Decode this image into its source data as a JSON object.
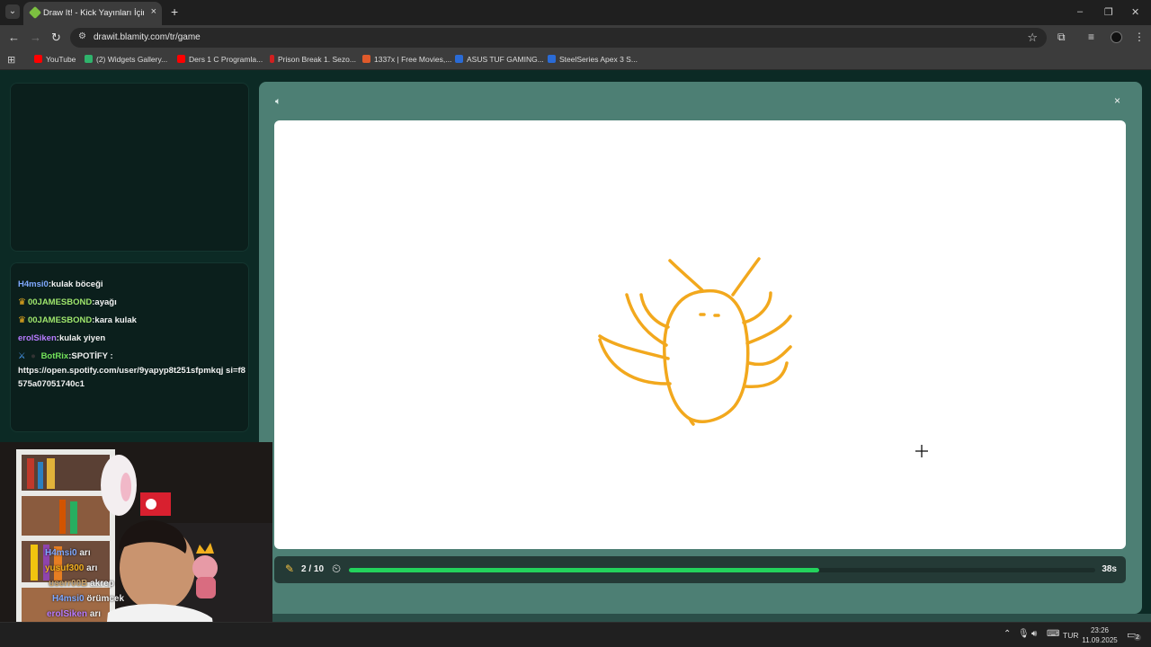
{
  "browser": {
    "tab_title": "Draw It! - Kick Yayınları İçin Çizim",
    "tab_close": "×",
    "new_tab": "+",
    "url": "drawit.blamity.com/tr/game",
    "window_controls": [
      "–",
      "❐",
      "✕"
    ],
    "bookmarks": [
      {
        "label": "YouTube",
        "color": "#ff0000"
      },
      {
        "label": "(2) Widgets Gallery...",
        "color": "#2fb36c"
      },
      {
        "label": "Ders 1 C Programla...",
        "color": "#ff0000"
      },
      {
        "label": "Prison Break 1. Sezo...",
        "color": "#d02020"
      },
      {
        "label": "1337x | Free Movies,...",
        "color": "#e05a2b"
      },
      {
        "label": "ASUS TUF GAMING...",
        "color": "#2a6bd6"
      },
      {
        "label": "SteelSeries Apex 3 S...",
        "color": "#2a6bd6"
      }
    ]
  },
  "chat": {
    "messages": [
      {
        "user": "H4msi0",
        "user_color": "blue",
        "text": ":kulak böceği",
        "crown": false
      },
      {
        "user": "00JAMESBOND",
        "user_color": "green",
        "text": ":ayağı",
        "crown": true
      },
      {
        "user": "00JAMESBOND",
        "user_color": "green",
        "text": ":kara kulak",
        "crown": true
      },
      {
        "user": "erolSiken",
        "user_color": "purple",
        "text": ":kulak yiyen",
        "crown": false
      }
    ],
    "bot": {
      "user": "BotRix",
      "text": ":SPOTİFY :"
    },
    "bot_link": "https://open.spotify.com/user/9yapyp8t251sfpmkqj si=f8575a07051740c1"
  },
  "game": {
    "round": "2 / 10",
    "progress_fraction": 0.63,
    "seconds": "38s",
    "sound_icon": "speaker-icon",
    "close": "×"
  },
  "webcam_chat": [
    {
      "user": "H4msi0",
      "text": "arı",
      "color": "#7fa9ff"
    },
    {
      "user": "yusuf300",
      "text": "arı",
      "color": "#f2b01e"
    },
    {
      "user": "userr00B",
      "text": "akrep",
      "color": "#c9a36b"
    },
    {
      "user": "H4msi0",
      "text": "örümcek",
      "color": "#7fa9ff"
    },
    {
      "user": "erolSiken",
      "text": "arı",
      "color": "#b77bff"
    }
  ],
  "taskbar": {
    "lang": "TUR",
    "time": "23:26",
    "date": "11.09.2025",
    "notifications": "2"
  }
}
